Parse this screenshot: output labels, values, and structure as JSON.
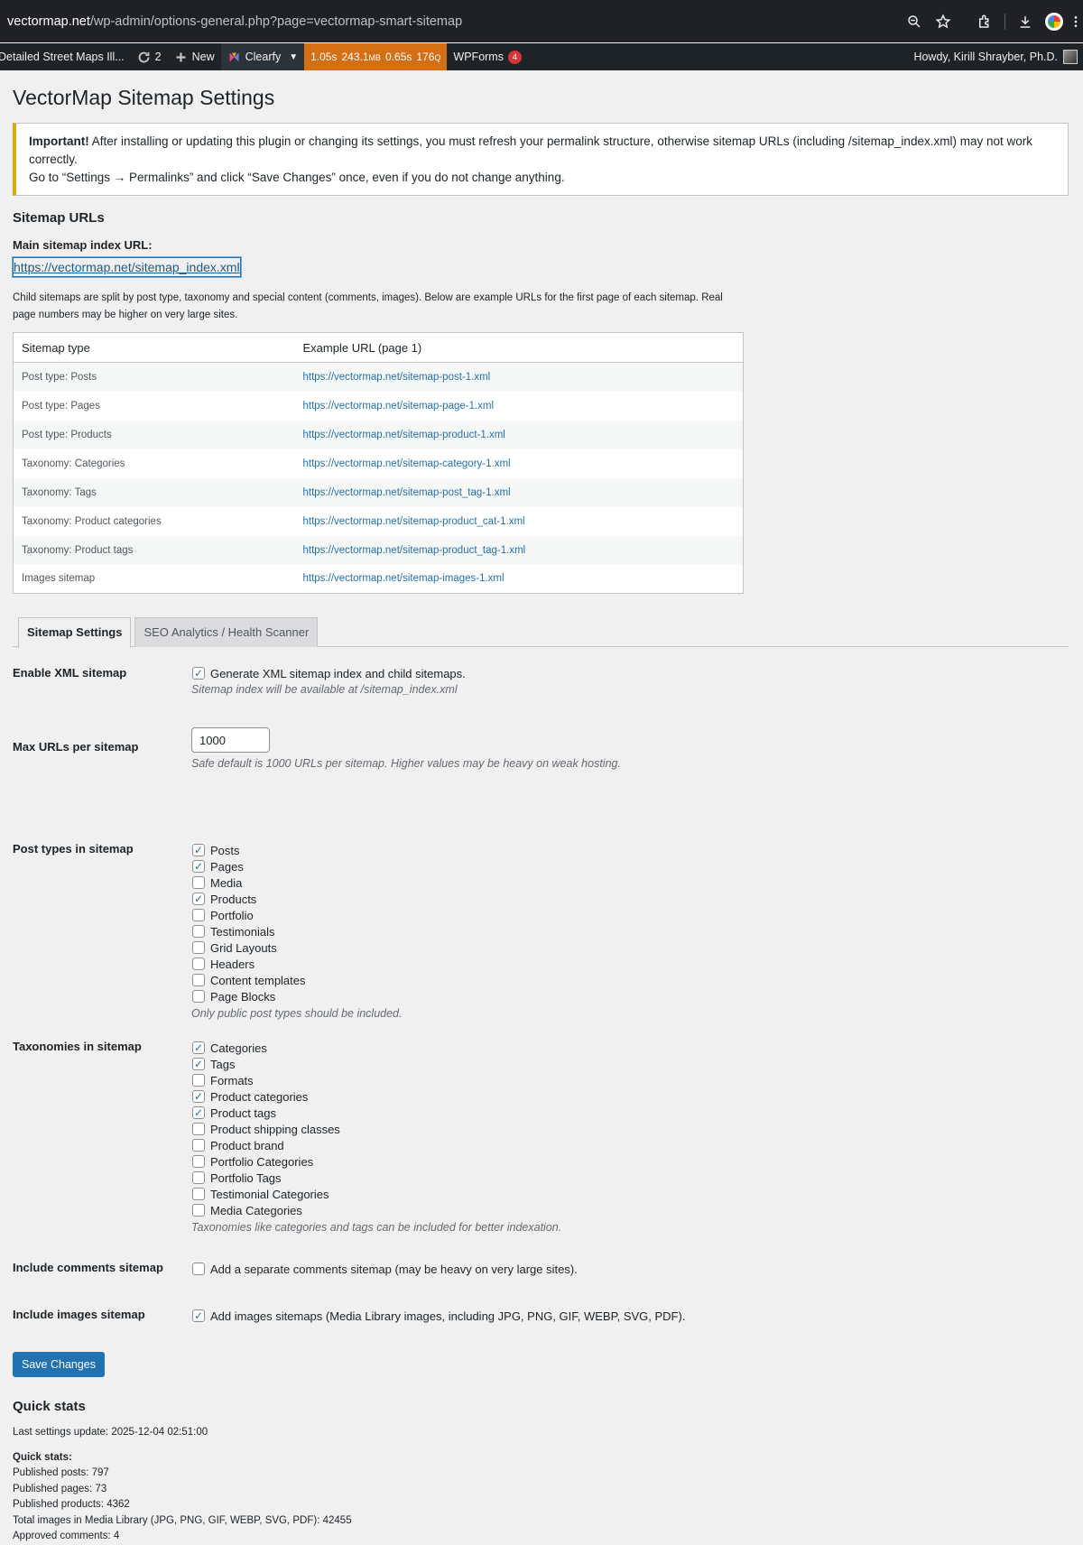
{
  "browser": {
    "url_domain": "vectormap.net",
    "url_path": "/wp-admin/options-general.php?page=vectormap-smart-sitemap"
  },
  "adminbar": {
    "site_name": "Detailed Street Maps Ill...",
    "updates_count": "2",
    "new_label": "New",
    "clearfy_label": "Clearfy",
    "perf_time": "1.05s",
    "perf_mem": "243.1",
    "perf_mem_unit": "MB",
    "perf_query_time": "0.65s",
    "perf_queries": "176",
    "perf_queries_unit": "Q",
    "wpforms_label": "WPForms",
    "wpforms_count": "4",
    "howdy": "Howdy, Kirill Shrayber, Ph.D."
  },
  "page": {
    "title": "VectorMap Sitemap Settings",
    "notice_bold": "Important!",
    "notice_text": " After installing or updating this plugin or changing its settings, you must refresh your permalink structure, otherwise sitemap URLs (including /sitemap_index.xml) may not work correctly.",
    "notice_line2": "Go to “Settings → Permalinks” and click “Save Changes” once, even if you do not change anything.",
    "sitemap_urls_heading": "Sitemap URLs",
    "main_index_label": "Main sitemap index URL:",
    "main_index_url": "https://vectormap.net/sitemap_index.xml",
    "child_desc": "Child sitemaps are split by post type, taxonomy and special content (comments, images). Below are example URLs for the first page of each sitemap. Real page numbers may be higher on very large sites."
  },
  "table": {
    "col_type": "Sitemap type",
    "col_url": "Example URL (page 1)",
    "rows": [
      {
        "type": "Post type: Posts",
        "url": "https://vectormap.net/sitemap-post-1.xml"
      },
      {
        "type": "Post type: Pages",
        "url": "https://vectormap.net/sitemap-page-1.xml"
      },
      {
        "type": "Post type: Products",
        "url": "https://vectormap.net/sitemap-product-1.xml"
      },
      {
        "type": "Taxonomy: Categories",
        "url": "https://vectormap.net/sitemap-category-1.xml"
      },
      {
        "type": "Taxonomy: Tags",
        "url": "https://vectormap.net/sitemap-post_tag-1.xml"
      },
      {
        "type": "Taxonomy: Product categories",
        "url": "https://vectormap.net/sitemap-product_cat-1.xml"
      },
      {
        "type": "Taxonomy: Product tags",
        "url": "https://vectormap.net/sitemap-product_tag-1.xml"
      },
      {
        "type": "Images sitemap",
        "url": "https://vectormap.net/sitemap-images-1.xml"
      }
    ]
  },
  "tabs": [
    "Sitemap Settings",
    "SEO Analytics / Health Scanner"
  ],
  "settings": {
    "enable_label": "Enable XML sitemap",
    "enable_cb": "Generate XML sitemap index and child sitemaps.",
    "enable_help": "Sitemap index will be available at /sitemap_index.xml",
    "max_label": "Max URLs per sitemap",
    "max_value": "1000",
    "max_help": "Safe default is 1000 URLs per sitemap. Higher values may be heavy on weak hosting.",
    "post_types_label": "Post types in sitemap",
    "post_types": [
      {
        "label": "Posts",
        "checked": true
      },
      {
        "label": "Pages",
        "checked": true
      },
      {
        "label": "Media",
        "checked": false
      },
      {
        "label": "Products",
        "checked": true
      },
      {
        "label": "Portfolio",
        "checked": false
      },
      {
        "label": "Testimonials",
        "checked": false
      },
      {
        "label": "Grid Layouts",
        "checked": false
      },
      {
        "label": "Headers",
        "checked": false
      },
      {
        "label": "Content templates",
        "checked": false
      },
      {
        "label": "Page Blocks",
        "checked": false
      }
    ],
    "post_types_help": "Only public post types should be included.",
    "taxonomies_label": "Taxonomies in sitemap",
    "taxonomies": [
      {
        "label": "Categories",
        "checked": true
      },
      {
        "label": "Tags",
        "checked": true
      },
      {
        "label": "Formats",
        "checked": false
      },
      {
        "label": "Product categories",
        "checked": true
      },
      {
        "label": "Product tags",
        "checked": true
      },
      {
        "label": "Product shipping classes",
        "checked": false
      },
      {
        "label": "Product brand",
        "checked": false
      },
      {
        "label": "Portfolio Categories",
        "checked": false
      },
      {
        "label": "Portfolio Tags",
        "checked": false
      },
      {
        "label": "Testimonial Categories",
        "checked": false
      },
      {
        "label": "Media Categories",
        "checked": false
      }
    ],
    "taxonomies_help": "Taxonomies like categories and tags can be included for better indexation.",
    "comments_label": "Include comments sitemap",
    "comments_cb": "Add a separate comments sitemap (may be heavy on very large sites).",
    "images_label": "Include images sitemap",
    "images_cb": "Add images sitemaps (Media Library images, including JPG, PNG, GIF, WEBP, SVG, PDF).",
    "save_button": "Save Changes"
  },
  "stats": {
    "heading": "Quick stats",
    "last_update": "Last settings update: 2025-12-04 02:51:00",
    "sub_heading": "Quick stats:",
    "lines": [
      "Published posts: 797",
      "Published pages: 73",
      "Published products: 4362",
      "Total images in Media Library (JPG, PNG, GIF, WEBP, SVG, PDF): 42455",
      "Approved comments: 4"
    ]
  },
  "colors": {
    "accent": "#2271b1",
    "notice_border": "#dba617",
    "admin_bar": "#1d2327",
    "perf_bar": "#d46f15",
    "badge": "#d63638"
  }
}
